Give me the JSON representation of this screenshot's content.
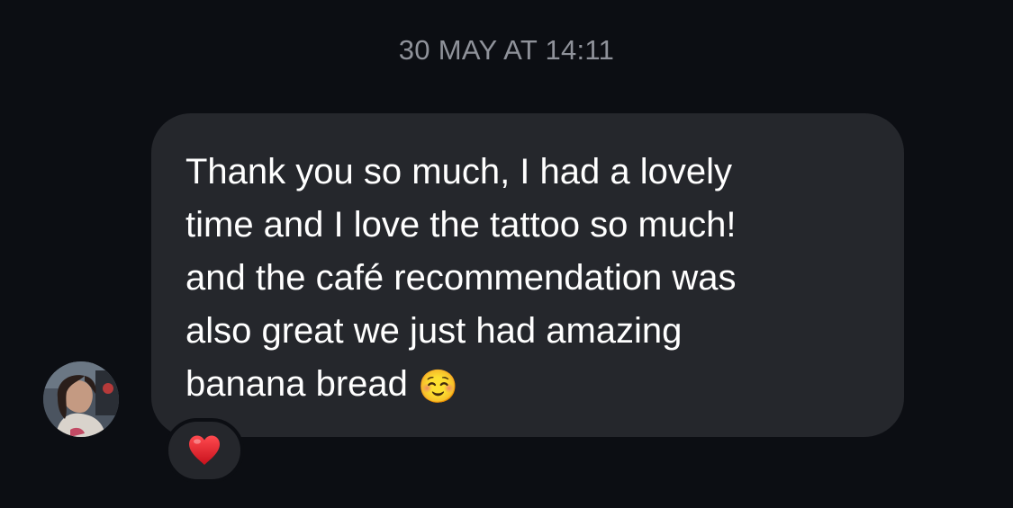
{
  "timestamp": "30 MAY AT 14:11",
  "message": {
    "text": "Thank you so much, I had a lovely\ntime and I love the tattoo so much!\nand the café recommendation was\nalso great we just had amazing\nbanana bread",
    "emoji": "☺️"
  },
  "reaction": {
    "emoji": "❤️"
  },
  "colors": {
    "background": "#0c0e13",
    "bubble": "#25272c",
    "timestamp": "#8f929a",
    "text": "#ffffff",
    "heart": "#e0242e"
  }
}
